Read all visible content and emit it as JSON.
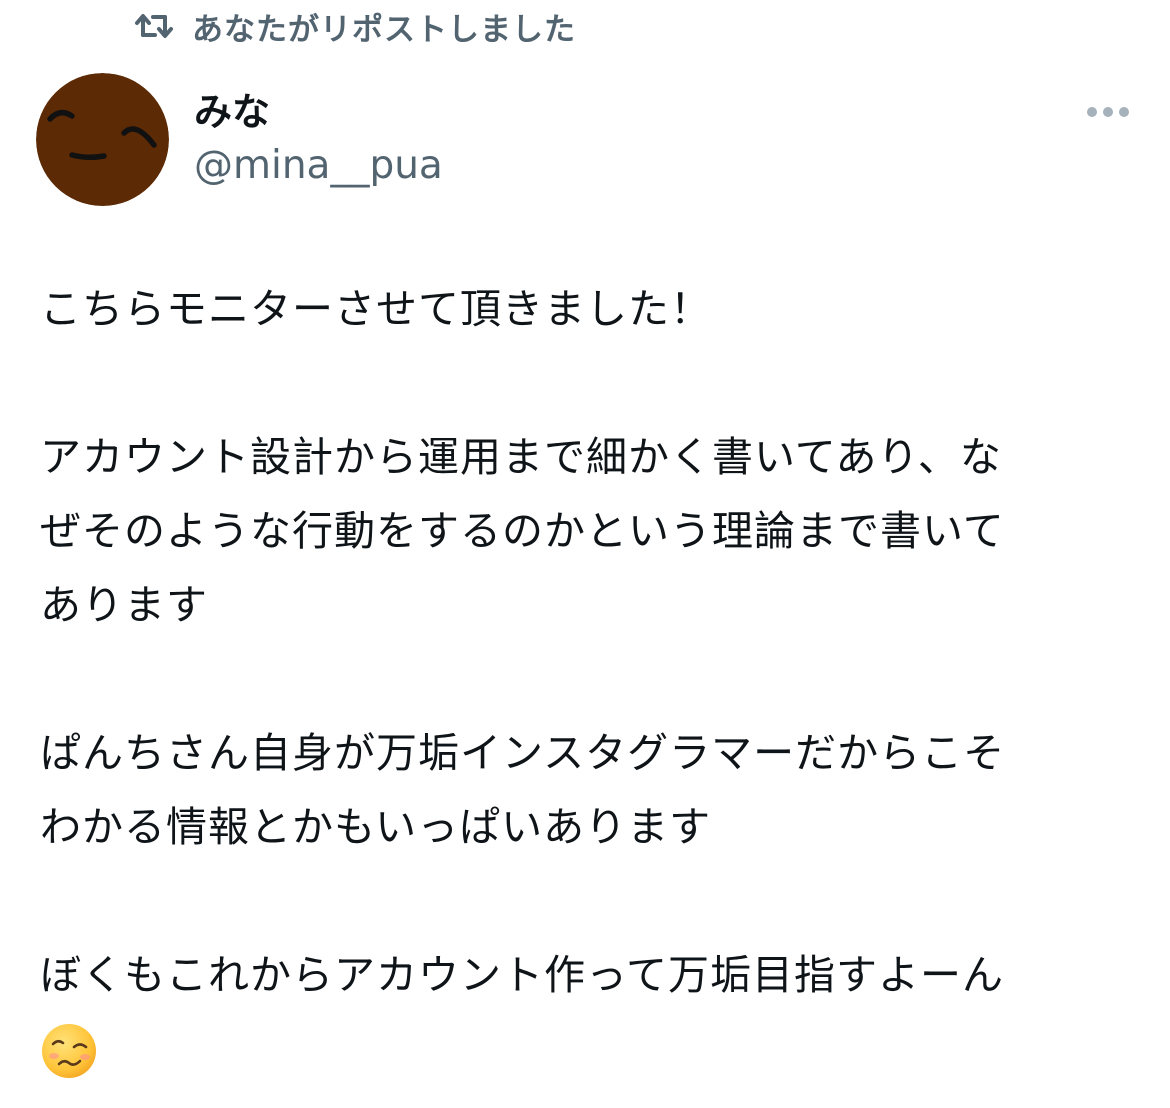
{
  "repost_header": {
    "icon": "repost-icon",
    "text": "あなたがリポストしました"
  },
  "author": {
    "display_name": "みな",
    "handle": "@mina__pua",
    "avatar": "avatar-smiling-face"
  },
  "more_menu": {
    "icon": "more-dots-icon"
  },
  "tweet": {
    "paragraphs": [
      {
        "lines": [
          "こちらモニターさせて頂きました！"
        ]
      },
      {
        "lines": [
          "アカウント設計から運用まで細かく書いてあり、な",
          "ぜそのような行動をするのかという理論まで書いて",
          "あります"
        ]
      },
      {
        "lines": [
          "ぱんちさん自身が万垢インスタグラマーだからこそ",
          "わかる情報とかもいっぱいあります"
        ]
      },
      {
        "lines": [
          "ぼくもこれからアカウント作って万垢目指すよーん"
        ]
      }
    ],
    "emoji": "woozy-face-emoji"
  },
  "colors": {
    "text": "#0f1419",
    "secondary_text": "#536471",
    "avatar_bg": "#5c2a05",
    "emoji_yellow": "#ffcf4a"
  }
}
